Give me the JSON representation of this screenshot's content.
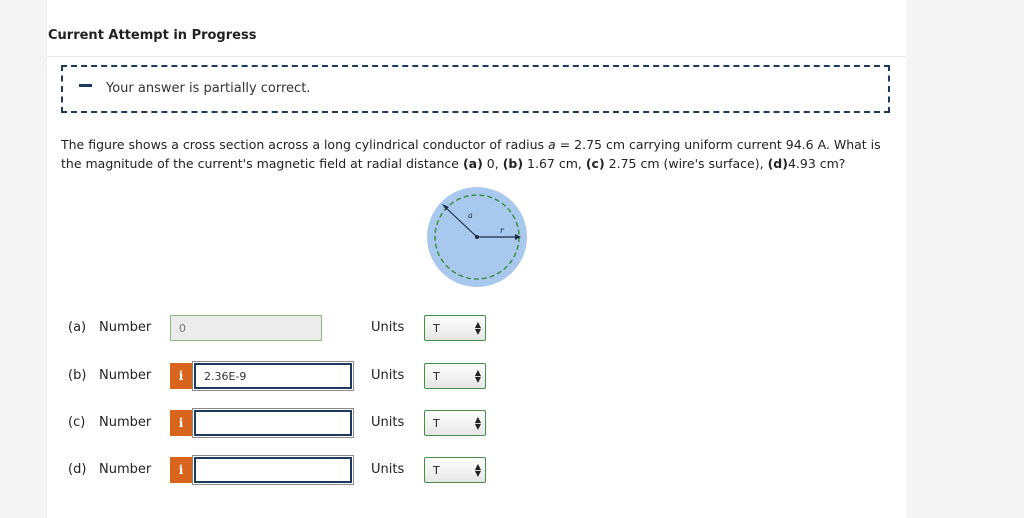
{
  "header": {
    "title": "Current Attempt in Progress"
  },
  "feedback": {
    "message": "Your answer is partially correct."
  },
  "question": {
    "text_1": "The figure shows a cross section across a long cylindrical conductor of radius ",
    "var_a": "a",
    "text_2": " = 2.75 cm carrying uniform current 94.6 A. What is the magnitude of the current's magnetic field at radial distance ",
    "pa": "(a)",
    "text_3": " 0, ",
    "pb": "(b)",
    "text_4": " 1.67 cm, ",
    "pc": "(c)",
    "text_5": " 2.75 cm (wire's surface), ",
    "pd": "(d)",
    "text_6": "4.93 cm?"
  },
  "figure": {
    "label_a": "a",
    "label_r": "r",
    "fill_color": "#a9c8ee",
    "ring_color": "#3f8f4a"
  },
  "answers": [
    {
      "part": "(a)",
      "number_label": "Number",
      "value": "0",
      "units_label": "Units",
      "unit": "T"
    },
    {
      "part": "(b)",
      "number_label": "Number",
      "value": "2.36E-9",
      "units_label": "Units",
      "unit": "T",
      "info": "i"
    },
    {
      "part": "(c)",
      "number_label": "Number",
      "value": "",
      "units_label": "Units",
      "unit": "T",
      "info": "i"
    },
    {
      "part": "(d)",
      "number_label": "Number",
      "value": "",
      "units_label": "Units",
      "unit": "T",
      "info": "i"
    }
  ]
}
